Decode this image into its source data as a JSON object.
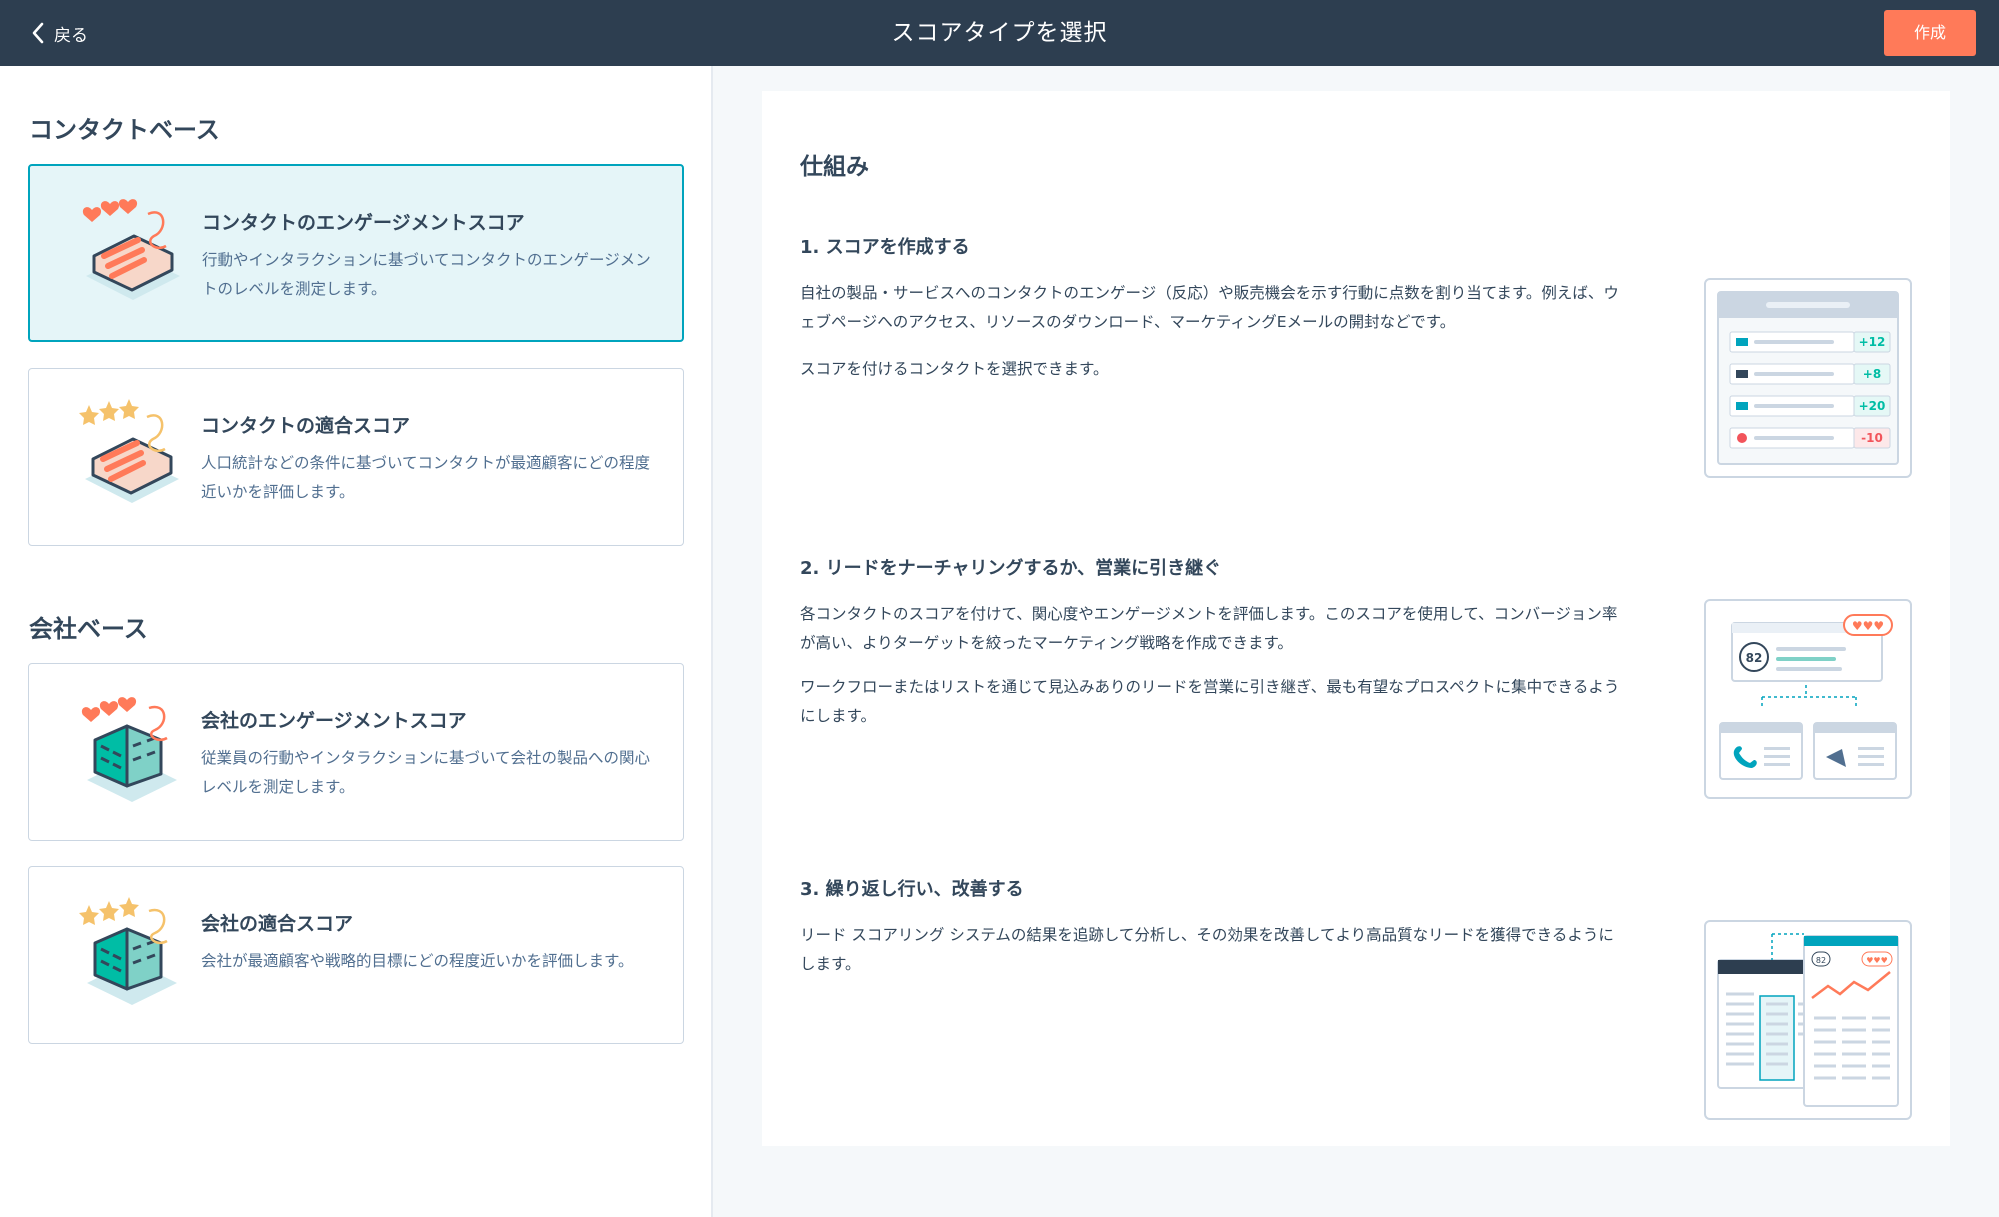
{
  "header": {
    "back_label": "戻る",
    "title": "スコアタイプを選択",
    "create_label": "作成"
  },
  "left": {
    "contact_section": "コンタクトベース",
    "company_section": "会社ベース",
    "cards": [
      {
        "title": "コンタクトのエンゲージメントスコア",
        "desc": "行動やインタラクションに基づいてコンタクトのエンゲージメントのレベルを測定します。",
        "icon": "contact-engagement-illustration",
        "selected": true
      },
      {
        "title": "コンタクトの適合スコア",
        "desc": "人口統計などの条件に基づいてコンタクトが最適顧客にどの程度近いかを評価します。",
        "icon": "contact-fit-illustration",
        "selected": false
      },
      {
        "title": "会社のエンゲージメントスコア",
        "desc": "従業員の行動やインタラクションに基づいて会社の製品への関心レベルを測定します。",
        "icon": "company-engagement-illustration",
        "selected": false
      },
      {
        "title": "会社の適合スコア",
        "desc": "会社が最適顧客や戦略的目標にどの程度近いかを評価します。",
        "icon": "company-fit-illustration",
        "selected": false
      }
    ]
  },
  "right": {
    "title": "仕組み",
    "steps": [
      {
        "title": "1. スコアを作成する",
        "para1": "自社の製品・サービスへのコンタクトのエンゲージ（反応）や販売機会を示す行動に点数を割り当てます。例えば、ウェブページへのアクセス、リソースのダウンロード、マーケティングEメールの開封などです。",
        "para2": "スコアを付けるコンタクトを選択できます。",
        "score_items": [
          "+12",
          "+8",
          "+20",
          "-10"
        ]
      },
      {
        "title": "2. リードをナーチャリングするか、営業に引き継ぐ",
        "para1": "各コンタクトのスコアを付けて、関心度やエンゲージメントを評価します。このスコアを使用して、コンバージョン率が高い、よりターゲットを絞ったマーケティング戦略を作成できます。",
        "para2": "ワークフローまたはリストを通じて見込みありのリードを営業に引き継ぎ、最も有望なプロスペクトに集中できるようにします。",
        "score": "82"
      },
      {
        "title": "3. 繰り返し行い、改善する",
        "para1": "リード スコアリング システムの結果を追跡して分析し、その効果を改善してより高品質なリードを獲得できるようにします。",
        "score": "82"
      }
    ]
  },
  "colors": {
    "header_bg": "#2d3e50",
    "accent": "#ff7a59",
    "selected_border": "#00a4bd",
    "selected_bg": "#e5f5f8",
    "positive": "#00bda5",
    "negative": "#f2545b"
  }
}
